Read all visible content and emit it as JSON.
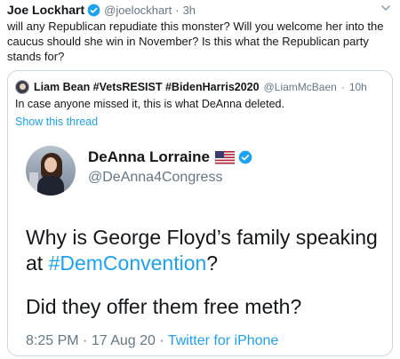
{
  "tweet": {
    "author_name": "Joe Lockhart",
    "author_handle": "@joelockhart",
    "separator": "·",
    "time": "3h",
    "text": "will any Republican repudiate this monster?  Will you welcome her into the caucus should she win in November?  Is this what the Republican party stands for?"
  },
  "quote": {
    "author_name": "Liam Bean #VetsRESIST #BidenHarris2020",
    "author_handle": "@LiamMcBaen",
    "separator": "·",
    "time": "10h",
    "text": "In case anyone missed it, this is what DeAnna deleted.",
    "show_thread": "Show this thread"
  },
  "embedded": {
    "name": "DeAnna Lorraine",
    "handle": "@DeAnna4Congress",
    "text_before": "Why is George Floyd’s family speaking at ",
    "hashtag": "#DemConvention",
    "text_after": "?",
    "text2": "Did they offer them free meth?",
    "time": "8:25 PM",
    "date": "17 Aug 20",
    "source": "Twitter for iPhone",
    "separator": "·"
  },
  "colors": {
    "link": "#1da1f2",
    "secondary": "#657786",
    "primary": "#14171a",
    "border": "#ccd6dd"
  },
  "icons": [
    "verified-badge-icon",
    "chevron-down-icon",
    "us-flag-icon"
  ]
}
